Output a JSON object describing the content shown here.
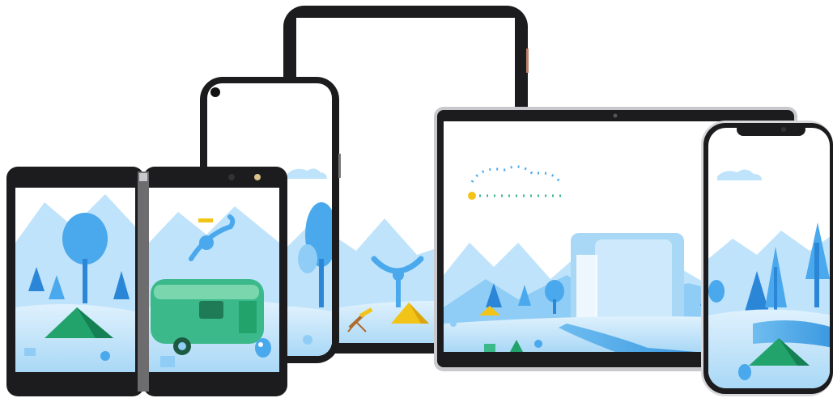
{
  "scene": {
    "devices": [
      {
        "kind": "dual-screen foldable"
      },
      {
        "kind": "phone"
      },
      {
        "kind": "tablet"
      },
      {
        "kind": "laptop"
      },
      {
        "kind": "phone with notch"
      }
    ],
    "colors": {
      "sky": "#ffffff",
      "mountain_light": "#bfe3fb",
      "mountain_mid": "#8fcdf6",
      "tree_blue": "#4aa8ec",
      "tree_dark": "#2b86d8",
      "ground": "#cde9fb",
      "ground_dark": "#8ec9f3",
      "tent_green": "#21a36b",
      "trailer_green": "#3cb98a",
      "tent_yellow": "#f2c418",
      "bezel": "#1c1c1e",
      "frame": "#d9d9dc"
    }
  }
}
